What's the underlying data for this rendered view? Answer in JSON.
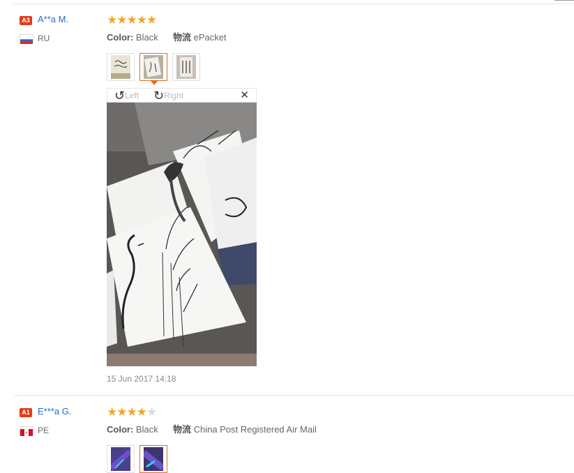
{
  "reviews": [
    {
      "level": "A3",
      "name": "A**a M.",
      "country": "RU",
      "rating": 5,
      "color_label": "Color:",
      "color_value": "Black",
      "shipping_label": "物流",
      "shipping_value": "ePacket",
      "viewer": {
        "rotate_left": "Left",
        "rotate_right": "Right"
      },
      "date": "15 Jun 2017 14:18"
    },
    {
      "level": "A1",
      "name": "E***a G.",
      "country": "PE",
      "rating": 4,
      "color_label": "Color:",
      "color_value": "Black",
      "shipping_label": "物流",
      "shipping_value": "China Post Registered Air Mail"
    }
  ],
  "colors": {
    "link": "#1c6cd6",
    "star": "#f5a623",
    "badge": "#e03b1c",
    "active_border": "#e86a1a"
  }
}
